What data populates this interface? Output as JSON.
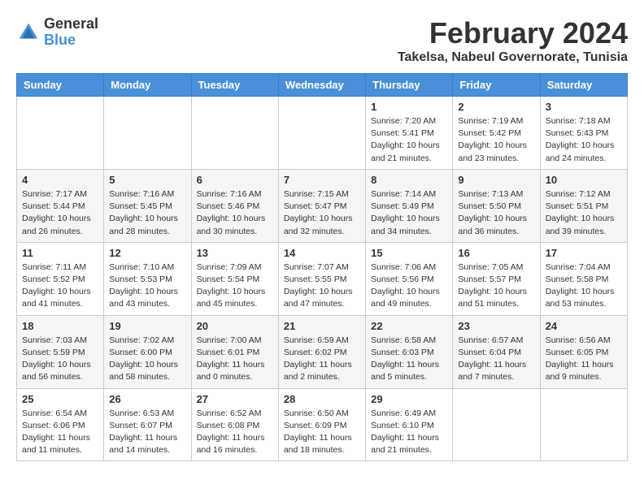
{
  "logo": {
    "general": "General",
    "blue": "Blue"
  },
  "title": "February 2024",
  "location": "Takelsa, Nabeul Governorate, Tunisia",
  "days_of_week": [
    "Sunday",
    "Monday",
    "Tuesday",
    "Wednesday",
    "Thursday",
    "Friday",
    "Saturday"
  ],
  "weeks": [
    [
      {
        "day": "",
        "info": ""
      },
      {
        "day": "",
        "info": ""
      },
      {
        "day": "",
        "info": ""
      },
      {
        "day": "",
        "info": ""
      },
      {
        "day": "1",
        "info": "Sunrise: 7:20 AM\nSunset: 5:41 PM\nDaylight: 10 hours\nand 21 minutes."
      },
      {
        "day": "2",
        "info": "Sunrise: 7:19 AM\nSunset: 5:42 PM\nDaylight: 10 hours\nand 23 minutes."
      },
      {
        "day": "3",
        "info": "Sunrise: 7:18 AM\nSunset: 5:43 PM\nDaylight: 10 hours\nand 24 minutes."
      }
    ],
    [
      {
        "day": "4",
        "info": "Sunrise: 7:17 AM\nSunset: 5:44 PM\nDaylight: 10 hours\nand 26 minutes."
      },
      {
        "day": "5",
        "info": "Sunrise: 7:16 AM\nSunset: 5:45 PM\nDaylight: 10 hours\nand 28 minutes."
      },
      {
        "day": "6",
        "info": "Sunrise: 7:16 AM\nSunset: 5:46 PM\nDaylight: 10 hours\nand 30 minutes."
      },
      {
        "day": "7",
        "info": "Sunrise: 7:15 AM\nSunset: 5:47 PM\nDaylight: 10 hours\nand 32 minutes."
      },
      {
        "day": "8",
        "info": "Sunrise: 7:14 AM\nSunset: 5:49 PM\nDaylight: 10 hours\nand 34 minutes."
      },
      {
        "day": "9",
        "info": "Sunrise: 7:13 AM\nSunset: 5:50 PM\nDaylight: 10 hours\nand 36 minutes."
      },
      {
        "day": "10",
        "info": "Sunrise: 7:12 AM\nSunset: 5:51 PM\nDaylight: 10 hours\nand 39 minutes."
      }
    ],
    [
      {
        "day": "11",
        "info": "Sunrise: 7:11 AM\nSunset: 5:52 PM\nDaylight: 10 hours\nand 41 minutes."
      },
      {
        "day": "12",
        "info": "Sunrise: 7:10 AM\nSunset: 5:53 PM\nDaylight: 10 hours\nand 43 minutes."
      },
      {
        "day": "13",
        "info": "Sunrise: 7:09 AM\nSunset: 5:54 PM\nDaylight: 10 hours\nand 45 minutes."
      },
      {
        "day": "14",
        "info": "Sunrise: 7:07 AM\nSunset: 5:55 PM\nDaylight: 10 hours\nand 47 minutes."
      },
      {
        "day": "15",
        "info": "Sunrise: 7:06 AM\nSunset: 5:56 PM\nDaylight: 10 hours\nand 49 minutes."
      },
      {
        "day": "16",
        "info": "Sunrise: 7:05 AM\nSunset: 5:57 PM\nDaylight: 10 hours\nand 51 minutes."
      },
      {
        "day": "17",
        "info": "Sunrise: 7:04 AM\nSunset: 5:58 PM\nDaylight: 10 hours\nand 53 minutes."
      }
    ],
    [
      {
        "day": "18",
        "info": "Sunrise: 7:03 AM\nSunset: 5:59 PM\nDaylight: 10 hours\nand 56 minutes."
      },
      {
        "day": "19",
        "info": "Sunrise: 7:02 AM\nSunset: 6:00 PM\nDaylight: 10 hours\nand 58 minutes."
      },
      {
        "day": "20",
        "info": "Sunrise: 7:00 AM\nSunset: 6:01 PM\nDaylight: 11 hours\nand 0 minutes."
      },
      {
        "day": "21",
        "info": "Sunrise: 6:59 AM\nSunset: 6:02 PM\nDaylight: 11 hours\nand 2 minutes."
      },
      {
        "day": "22",
        "info": "Sunrise: 6:58 AM\nSunset: 6:03 PM\nDaylight: 11 hours\nand 5 minutes."
      },
      {
        "day": "23",
        "info": "Sunrise: 6:57 AM\nSunset: 6:04 PM\nDaylight: 11 hours\nand 7 minutes."
      },
      {
        "day": "24",
        "info": "Sunrise: 6:56 AM\nSunset: 6:05 PM\nDaylight: 11 hours\nand 9 minutes."
      }
    ],
    [
      {
        "day": "25",
        "info": "Sunrise: 6:54 AM\nSunset: 6:06 PM\nDaylight: 11 hours\nand 11 minutes."
      },
      {
        "day": "26",
        "info": "Sunrise: 6:53 AM\nSunset: 6:07 PM\nDaylight: 11 hours\nand 14 minutes."
      },
      {
        "day": "27",
        "info": "Sunrise: 6:52 AM\nSunset: 6:08 PM\nDaylight: 11 hours\nand 16 minutes."
      },
      {
        "day": "28",
        "info": "Sunrise: 6:50 AM\nSunset: 6:09 PM\nDaylight: 11 hours\nand 18 minutes."
      },
      {
        "day": "29",
        "info": "Sunrise: 6:49 AM\nSunset: 6:10 PM\nDaylight: 11 hours\nand 21 minutes."
      },
      {
        "day": "",
        "info": ""
      },
      {
        "day": "",
        "info": ""
      }
    ]
  ]
}
